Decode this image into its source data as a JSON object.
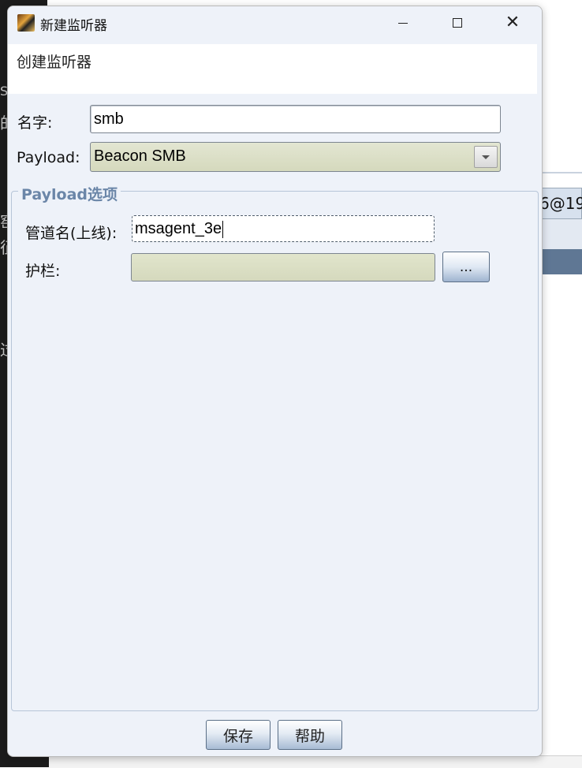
{
  "window": {
    "title": "新建监听器",
    "app_icon": "cobalt-strike-app-icon",
    "controls": {
      "minimize": "minimize-icon",
      "maximize": "maximize-icon",
      "close": "close-icon"
    }
  },
  "header": {
    "title": "创建监听器"
  },
  "form": {
    "name_label": "名字:",
    "name_value": "smb",
    "payload_label": "Payload:",
    "payload_value": "Beacon SMB"
  },
  "payload_options": {
    "group_title": "Payload选项",
    "pipe_label": "管道名(上线):",
    "pipe_value": "msagent_3e",
    "guard_label": "护栏:",
    "guard_value": "",
    "browse_label": "..."
  },
  "footer": {
    "save_label": "保存",
    "help_label": "帮助"
  },
  "background": {
    "left_fragments": [
      "S",
      "的",
      "窑",
      "征",
      "过"
    ],
    "right_fragment": "6@19"
  },
  "colors": {
    "dialog_bg": "#eef2f9",
    "combo_bg": "#d5d9bd",
    "group_title": "#6b86a8"
  }
}
